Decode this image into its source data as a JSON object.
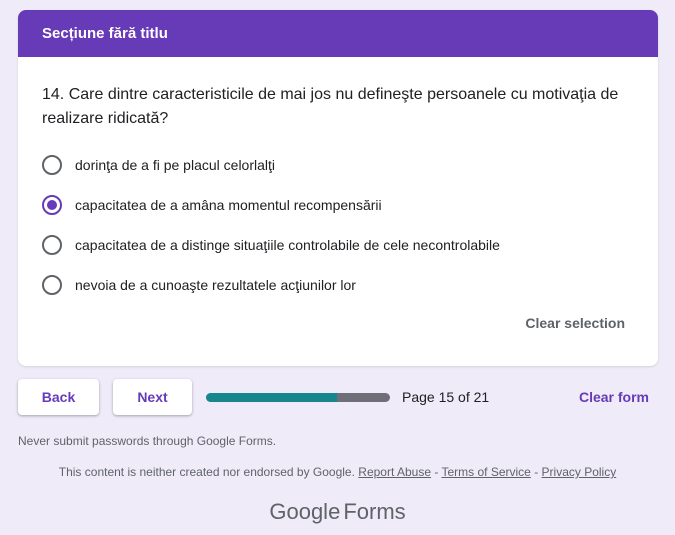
{
  "section": {
    "title": "Secțiune fără titlu"
  },
  "question": {
    "text": "14. Care dintre caracteristicile de mai jos nu defineşte persoanele cu motivaţia de realizare ridicată?",
    "options": [
      {
        "label": "dorinţa de a fi pe placul celorlalţi",
        "selected": false
      },
      {
        "label": "capacitatea de a amâna momentul recompensării",
        "selected": true
      },
      {
        "label": "capacitatea de a distinge situaţiile controlabile de cele necontrolabile",
        "selected": false
      },
      {
        "label": "nevoia de a cunoaşte rezultatele acţiunilor lor",
        "selected": false
      }
    ],
    "clear_selection": "Clear selection"
  },
  "navigation": {
    "back": "Back",
    "next": "Next",
    "page_indicator": "Page 15 of 21",
    "progress": 0.714,
    "clear_form": "Clear form"
  },
  "footer": {
    "warning": "Never submit passwords through Google Forms.",
    "disclaimer": "This content is neither created nor endorsed by Google.",
    "report_abuse": "Report Abuse",
    "terms": "Terms of Service",
    "privacy": "Privacy Policy",
    "logo_google": "Google",
    "logo_forms": "Forms"
  },
  "colors": {
    "accent": "#673ab7",
    "background": "#efebf8",
    "progress_fill": "#17868f",
    "progress_track": "#6f6f78"
  }
}
